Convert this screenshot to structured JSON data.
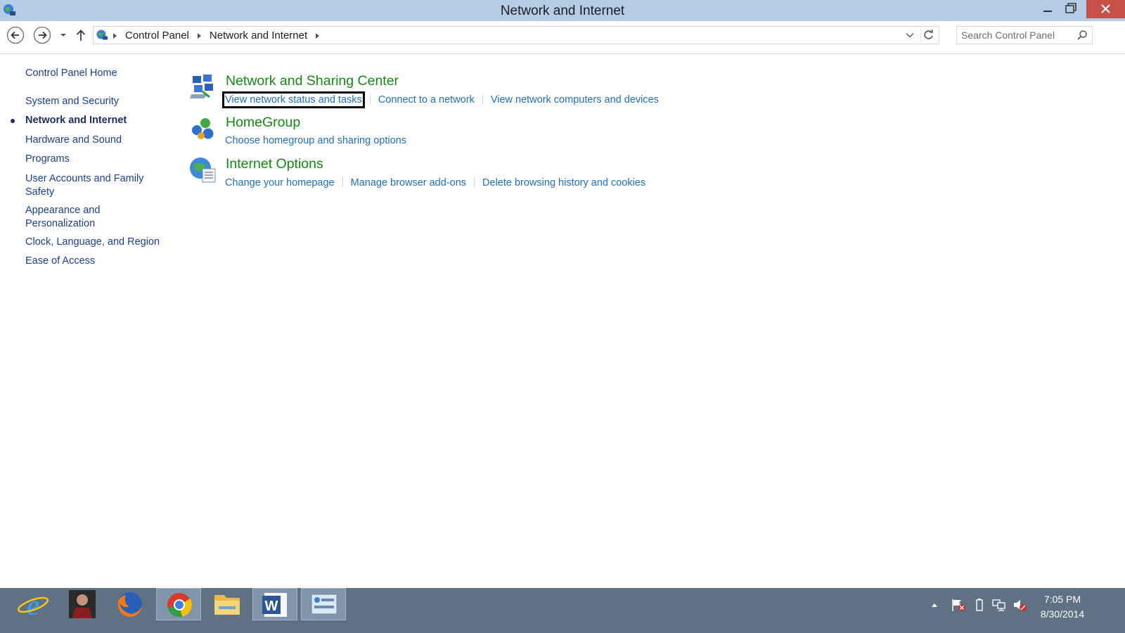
{
  "window": {
    "title": "Network and Internet"
  },
  "address": {
    "crumbs": [
      "Control Panel",
      "Network and Internet"
    ]
  },
  "search": {
    "placeholder": "Search Control Panel"
  },
  "leftnav": {
    "home": "Control Panel Home",
    "items": [
      {
        "label": "System and Security",
        "active": false
      },
      {
        "label": "Network and Internet",
        "active": true
      },
      {
        "label": "Hardware and Sound",
        "active": false
      },
      {
        "label": "Programs",
        "active": false
      },
      {
        "label": "User Accounts and Family Safety",
        "active": false
      },
      {
        "label": "Appearance and Personalization",
        "active": false
      },
      {
        "label": "Clock, Language, and Region",
        "active": false
      },
      {
        "label": "Ease of Access",
        "active": false
      }
    ]
  },
  "categories": [
    {
      "title": "Network and Sharing Center",
      "icon": "network-sharing-icon",
      "links": [
        "View network status and tasks",
        "Connect to a network",
        "View network computers and devices"
      ]
    },
    {
      "title": "HomeGroup",
      "icon": "homegroup-icon",
      "links": [
        "Choose homegroup and sharing options"
      ]
    },
    {
      "title": "Internet Options",
      "icon": "internet-options-icon",
      "links": [
        "Change your homepage",
        "Manage browser add-ons",
        "Delete browsing history and cookies"
      ]
    }
  ],
  "taskbar": {
    "apps": [
      "internet-explorer-icon",
      "game-character-icon",
      "firefox-icon",
      "chrome-icon",
      "file-explorer-icon",
      "word-icon",
      "control-panel-icon"
    ],
    "time": "7:05 PM",
    "date": "8/30/2014"
  },
  "colors": {
    "titlebar": "#b4cce6",
    "close": "#c7504a",
    "heading": "#138a13",
    "link": "#1f6fc1",
    "taskbar": "#5f7183"
  }
}
